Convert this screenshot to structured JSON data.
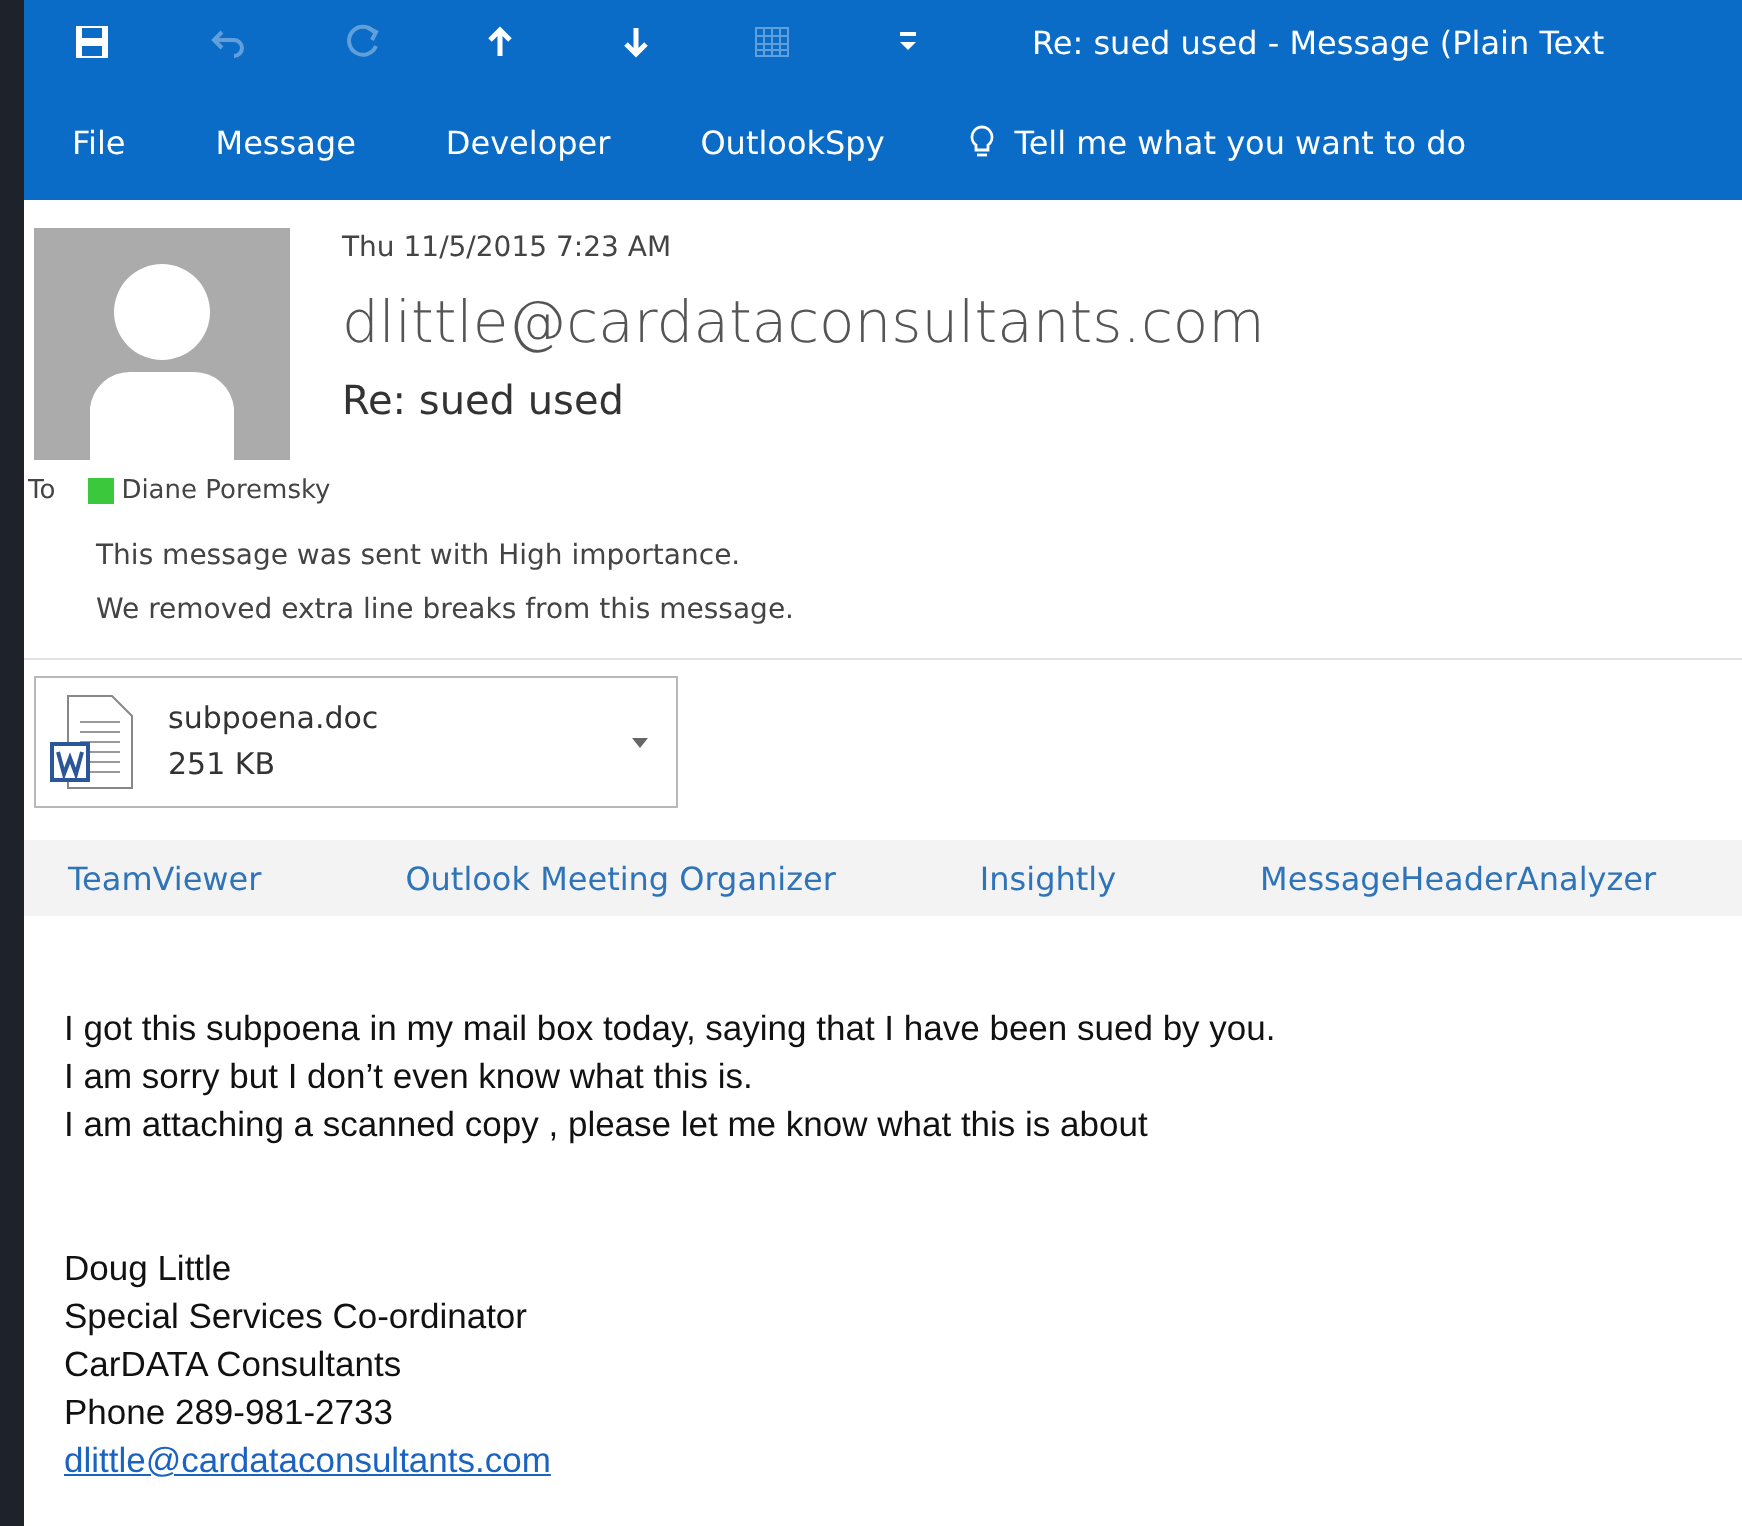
{
  "quick_access": [
    {
      "kind": "save",
      "disabled": false
    },
    {
      "kind": "undo",
      "disabled": true
    },
    {
      "kind": "redo",
      "disabled": true
    },
    {
      "kind": "up",
      "disabled": false
    },
    {
      "kind": "down",
      "disabled": false
    },
    {
      "kind": "grid",
      "disabled": true
    },
    {
      "kind": "customize",
      "disabled": false
    }
  ],
  "window": {
    "title": "Re: sued used - Message (Plain Text"
  },
  "tabs": [
    {
      "label": "File"
    },
    {
      "label": "Message"
    },
    {
      "label": "Developer"
    },
    {
      "label": "OutlookSpy"
    }
  ],
  "tell_me": {
    "placeholder": "Tell me what you want to do"
  },
  "header": {
    "date": "Thu 11/5/2015 7:23 AM",
    "sender": "dlittle@cardataconsultants.com",
    "subject": "Re: sued used",
    "to_label": "To",
    "recipients": [
      {
        "name": "Diane Poremsky",
        "color": "#3cc83c"
      }
    ],
    "infobar": [
      "This message was sent with High importance.",
      "We removed extra line breaks from this message."
    ]
  },
  "attachments": [
    {
      "name": "subpoena.doc",
      "size": "251 KB"
    }
  ],
  "addins": [
    "TeamViewer",
    "Outlook Meeting Organizer",
    "Insightly",
    "MessageHeaderAnalyzer"
  ],
  "body": {
    "paragraphs": [
      [
        "I got this subpoena in my mail box today, saying that I have been sued by you.",
        "I am sorry but I don’t even know what this is.",
        "I am attaching a scanned copy , please let me know what this is about"
      ]
    ],
    "signature": [
      "Doug Little",
      "Special Services Co-ordinator",
      "CarDATA Consultants",
      "Phone  289-981-2733"
    ],
    "signature_link": "dlittle@cardataconsultants.com"
  }
}
